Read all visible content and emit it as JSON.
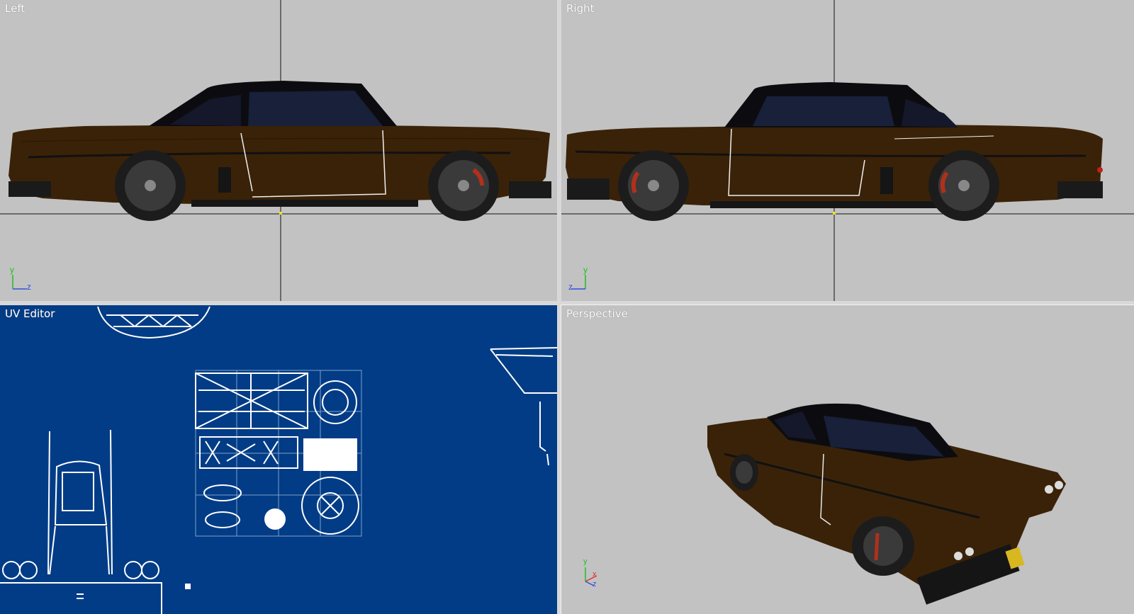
{
  "viewports": {
    "left": {
      "label": "Left",
      "axis_y": "y",
      "axis_h": "z"
    },
    "right": {
      "label": "Right",
      "axis_y": "y",
      "axis_h": "z"
    },
    "uv": {
      "label": "UV Editor"
    },
    "perspective": {
      "label": "Perspective",
      "axis_y": "y",
      "axis_x": "x",
      "axis_z": "z"
    }
  },
  "colors": {
    "viewport_bg": "#c2c2c2",
    "uv_bg": "#023c86",
    "car_body": "#3a2208",
    "car_roof": "#0d0d10",
    "wheel": "#2a2a2a",
    "brake": "#b0301c",
    "axis_y": "#20c020",
    "axis_z": "#3050e0",
    "axis_x": "#e03030"
  }
}
